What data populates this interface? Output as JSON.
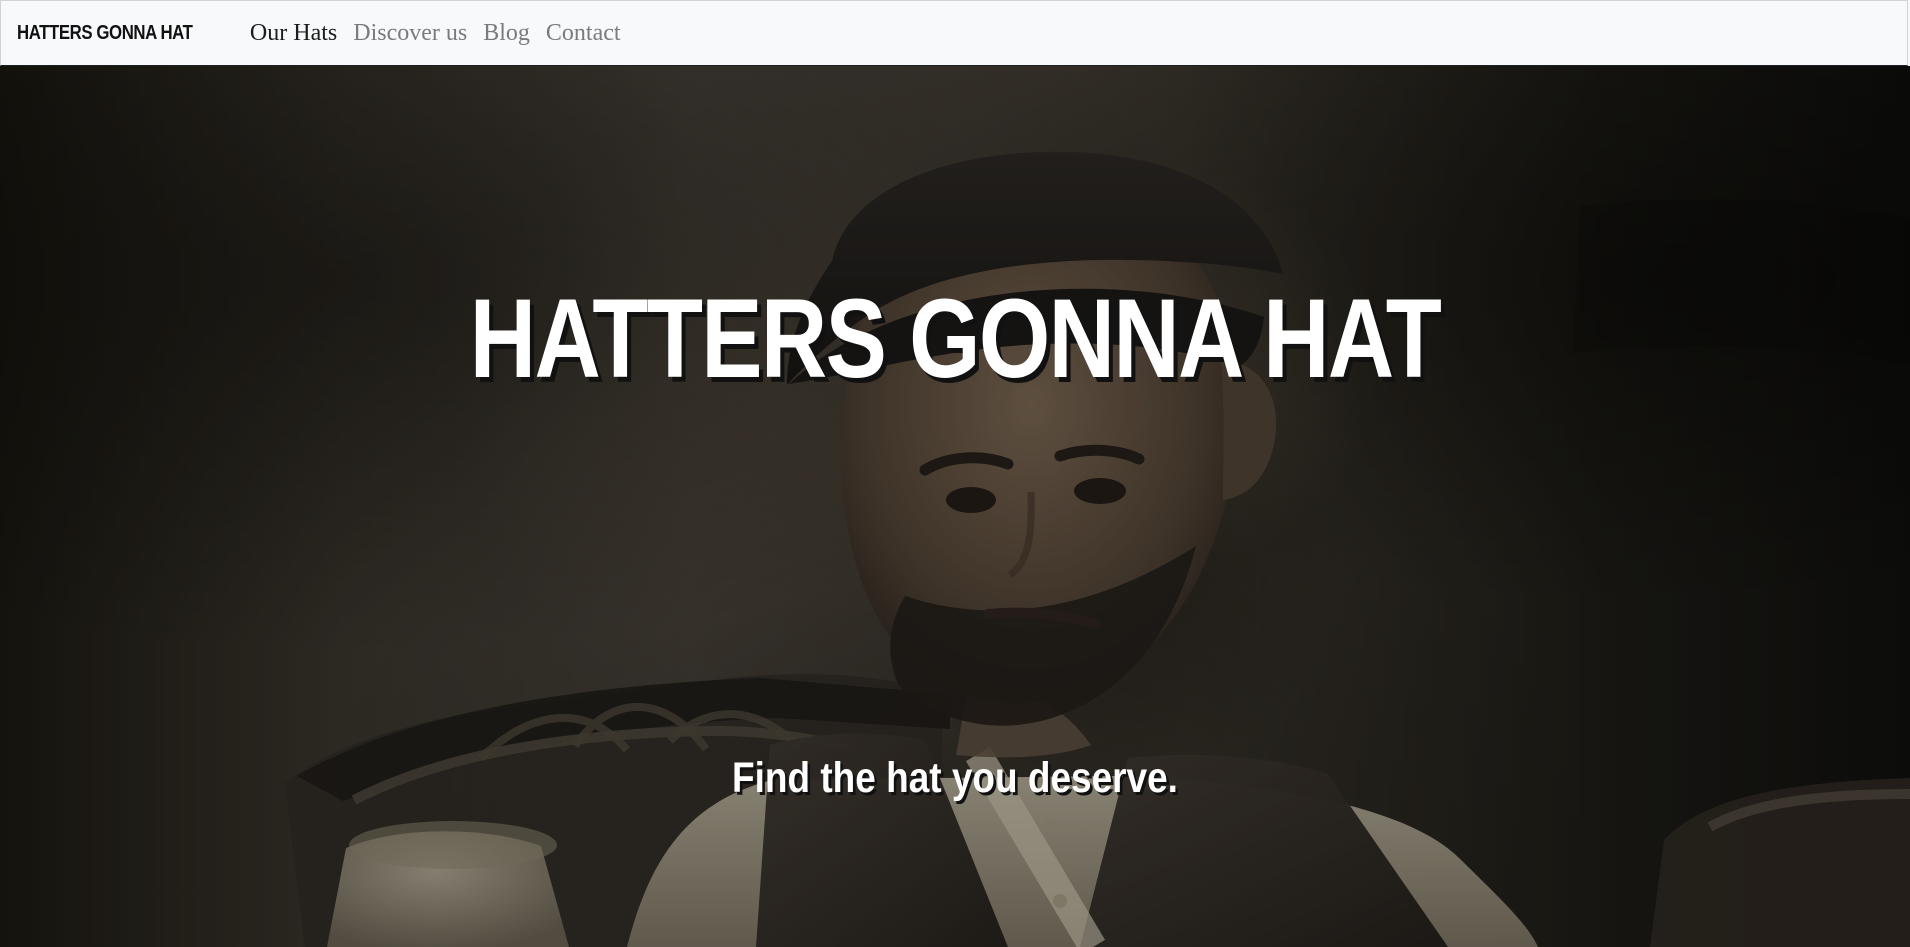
{
  "navbar": {
    "brand": "HATTERS GONNA HAT",
    "links": [
      {
        "label": "Our Hats",
        "active": true
      },
      {
        "label": "Discover us",
        "active": false
      },
      {
        "label": "Blog",
        "active": false
      },
      {
        "label": "Contact",
        "active": false
      }
    ]
  },
  "hero": {
    "title": "HATTERS GONNA HAT",
    "subtitle": "Find the hat you deserve."
  },
  "colors": {
    "nav_background": "#f8f9fb",
    "nav_text_active": "#1d1d1d",
    "nav_text_inactive": "#7b7b7b",
    "hero_text": "#ffffff"
  }
}
